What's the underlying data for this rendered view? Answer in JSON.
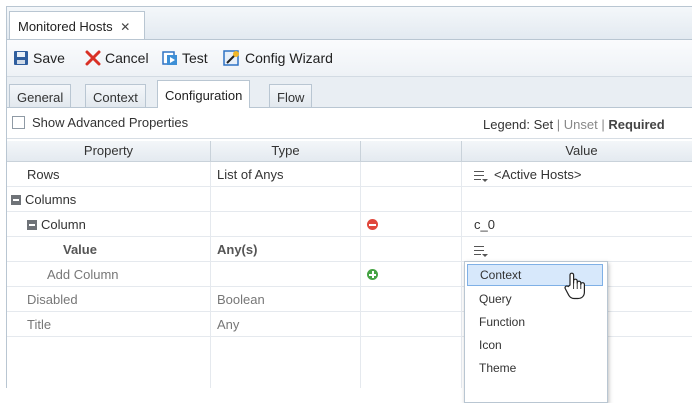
{
  "doc_tab": {
    "label": "Monitored Hosts",
    "close": "✕"
  },
  "toolbar": {
    "save": "Save",
    "cancel": "Cancel",
    "test": "Test",
    "config_wizard": "Config Wizard"
  },
  "sub_tabs": [
    "General",
    "Context",
    "Configuration",
    "Flow"
  ],
  "active_sub_tab": "Configuration",
  "props": {
    "show_advanced": "Show Advanced Properties",
    "show_advanced_checked": false,
    "legend_prefix": "Legend:",
    "legend_set": "Set",
    "legend_sep1": "|",
    "legend_unset": "Unset",
    "legend_sep2": "|",
    "legend_required": "Required"
  },
  "grid": {
    "headers": {
      "property": "Property",
      "type": "Type",
      "action": "",
      "value": "Value"
    },
    "rows": [
      {
        "property": "Rows",
        "type": "List of Anys",
        "value": "<Active Hosts>"
      },
      {
        "property": "Columns"
      },
      {
        "property": "Column",
        "value": "c_0"
      },
      {
        "property": "Value",
        "type": "Any(s)"
      },
      {
        "property": "Add Column"
      },
      {
        "property": "Disabled",
        "type": "Boolean"
      },
      {
        "property": "Title",
        "type": "Any"
      }
    ]
  },
  "dropdown": {
    "items": [
      "Context",
      "Query",
      "Function",
      "Icon",
      "Theme"
    ],
    "highlighted": "Context"
  },
  "colors": {
    "accent_blue": "#d7e8fb",
    "remove_red": "#e0473c",
    "add_green": "#45a343"
  }
}
